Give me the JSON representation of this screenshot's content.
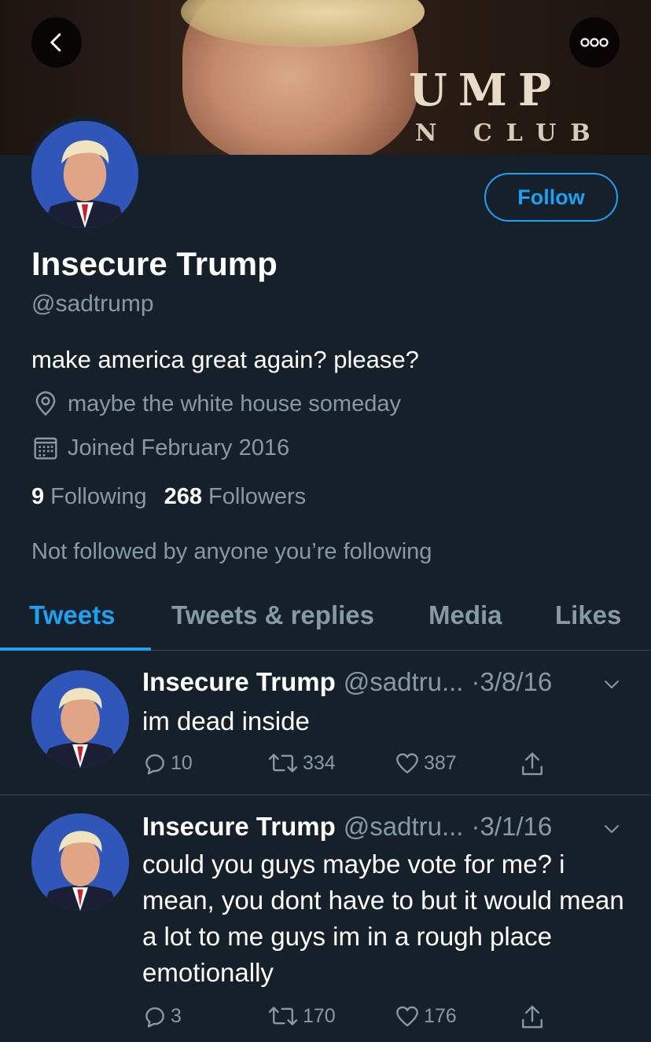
{
  "banner": {
    "text_line1": "UMP",
    "text_line2": "N CLUB"
  },
  "nav": {
    "back_icon": "chevron-left-icon",
    "more_icon": "more-horizontal-icon"
  },
  "profile": {
    "follow_label": "Follow",
    "name": "Insecure Trump",
    "handle": "@sadtrump",
    "bio": "make america great again? please?",
    "location": "maybe the white house someday",
    "joined": "Joined February 2016",
    "following_count": "9",
    "following_label": "Following",
    "followers_count": "268",
    "followers_label": "Followers",
    "not_followed": "Not followed by anyone you’re following"
  },
  "tabs": [
    {
      "label": "Tweets",
      "active": true
    },
    {
      "label": "Tweets & replies",
      "active": false
    },
    {
      "label": "Media",
      "active": false
    },
    {
      "label": "Likes",
      "active": false
    }
  ],
  "tweets": [
    {
      "name": "Insecure Trump",
      "handle": "@sadtru...",
      "date": "·3/8/16",
      "text": "im dead inside",
      "replies": "10",
      "retweets": "334",
      "likes": "387"
    },
    {
      "name": "Insecure Trump",
      "handle": "@sadtru...",
      "date": "·3/1/16",
      "text": "could you guys maybe vote for me? i mean, you dont have to but it would mean a lot to me guys im in a rough place emotionally",
      "replies": "3",
      "retweets": "170",
      "likes": "176"
    }
  ],
  "colors": {
    "background": "#15202b",
    "accent": "#1da1f2",
    "secondary_text": "#8899a6",
    "divider": "#38444d"
  }
}
